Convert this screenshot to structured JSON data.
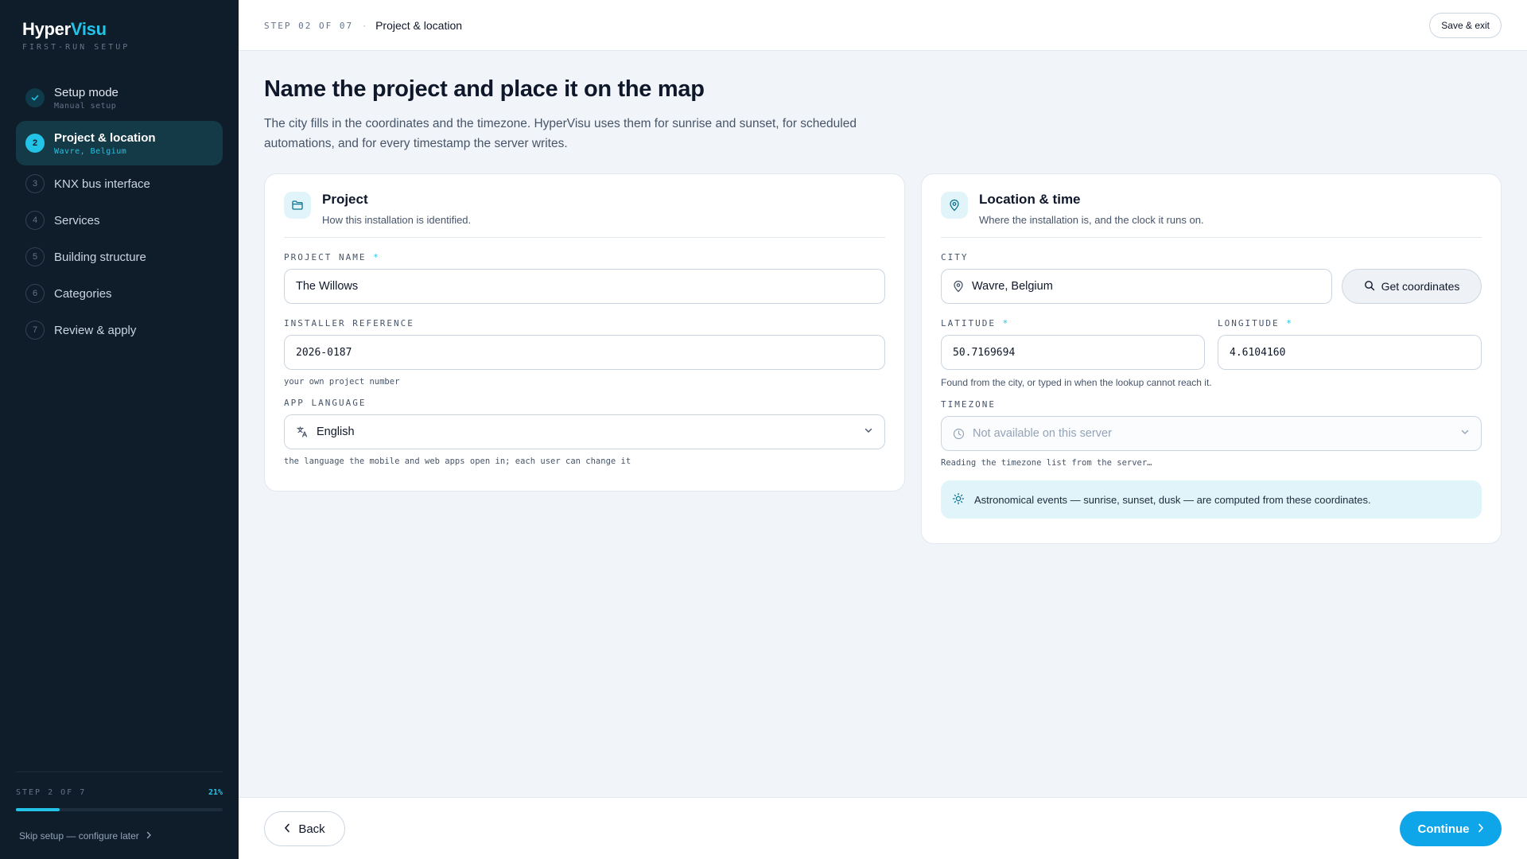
{
  "brand": {
    "name_a": "Hyper",
    "name_b": "Visu",
    "subtitle": "FIRST-RUN SETUP"
  },
  "sidebar": {
    "steps": [
      {
        "num": "✓",
        "label": "Setup mode",
        "sub": "Manual setup",
        "state": "done"
      },
      {
        "num": "2",
        "label": "Project & location",
        "sub": "Wavre, Belgium",
        "state": "active"
      },
      {
        "num": "3",
        "label": "KNX bus interface",
        "sub": "",
        "state": "todo"
      },
      {
        "num": "4",
        "label": "Services",
        "sub": "",
        "state": "todo"
      },
      {
        "num": "5",
        "label": "Building structure",
        "sub": "",
        "state": "todo"
      },
      {
        "num": "6",
        "label": "Categories",
        "sub": "",
        "state": "todo"
      },
      {
        "num": "7",
        "label": "Review & apply",
        "sub": "",
        "state": "todo"
      }
    ],
    "progress_label": "STEP 2 OF 7",
    "progress_pct": "21%",
    "progress_value": 0.21,
    "skip_label": "Skip setup — configure later"
  },
  "topbar": {
    "step_label": "STEP 02 OF 07",
    "separator": "·",
    "current": "Project & location",
    "save_exit": "Save & exit"
  },
  "main": {
    "title": "Name the project and place it on the map",
    "description": "The city fills in the coordinates and the timezone. HyperVisu uses them for sunrise and sunset, for scheduled automations, and for every timestamp the server writes."
  },
  "project": {
    "title": "Project",
    "subtitle": "How this installation is identified.",
    "name_label": "PROJECT NAME",
    "name_value": "The Willows",
    "ref_label": "INSTALLER REFERENCE",
    "ref_value": "2026-0187",
    "ref_hint": "your own project number",
    "lang_label": "APP LANGUAGE",
    "lang_value": "English",
    "lang_hint": "the language the mobile and web apps open in; each user can change it"
  },
  "location": {
    "title": "Location & time",
    "subtitle": "Where the installation is, and the clock it runs on.",
    "city_label": "CITY",
    "city_value": "Wavre, Belgium",
    "coord_button": "Get coordinates",
    "lat_label": "LATITUDE",
    "lat_value": "50.7169694",
    "lon_label": "LONGITUDE",
    "lon_value": "4.6104160",
    "coord_hint": "Found from the city, or typed in when the lookup cannot reach it.",
    "tz_label": "TIMEZONE",
    "tz_value": "Not available on this server",
    "tz_hint": "Reading the timezone list from the server…",
    "info": "Astronomical events — sunrise, sunset, dusk — are computed from these coordinates."
  },
  "required_mark": "*",
  "footer": {
    "back": "Back",
    "continue": "Continue"
  },
  "colors": {
    "accent": "#22c3e6",
    "primary_button": "#0ea5e9",
    "sidebar_bg": "#0f1c29"
  }
}
